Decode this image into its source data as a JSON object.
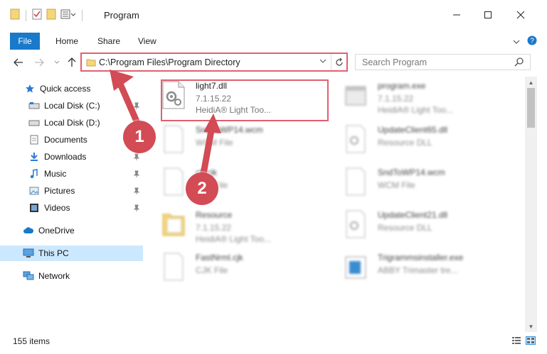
{
  "window": {
    "title": "Program"
  },
  "ribbon": {
    "tabs": [
      "File",
      "Home",
      "Share",
      "View"
    ]
  },
  "address": {
    "path": "C:\\Program Files\\Program Directory"
  },
  "search": {
    "placeholder": "Search Program"
  },
  "sidebar": {
    "items": [
      {
        "label": "Quick access",
        "icon": "star-icon"
      },
      {
        "label": "Local Disk (C:)",
        "icon": "drive-icon"
      },
      {
        "label": "Local Disk (D:)",
        "icon": "drive-icon"
      },
      {
        "label": "Documents",
        "icon": "documents-icon"
      },
      {
        "label": "Downloads",
        "icon": "downloads-icon"
      },
      {
        "label": "Music",
        "icon": "music-icon"
      },
      {
        "label": "Pictures",
        "icon": "pictures-icon"
      },
      {
        "label": "Videos",
        "icon": "videos-icon"
      },
      {
        "label": "OneDrive",
        "icon": "cloud-icon"
      },
      {
        "label": "This PC",
        "icon": "computer-icon"
      },
      {
        "label": "Network",
        "icon": "network-icon"
      }
    ]
  },
  "files": [
    {
      "name": "light7.dll",
      "line2": "7.1.15.22",
      "line3": "HeidiA® Light Too..."
    },
    {
      "name": "program.exe",
      "line2": "7.1.15.22",
      "line3": "HeidiA® Light Too..."
    },
    {
      "name": "SndToWP14.wcm",
      "line2": "WCM File",
      "line3": ""
    },
    {
      "name": "UpdateClient65.dll",
      "line2": "Resource DLL",
      "line3": ""
    },
    {
      "name": "cfl.cjk",
      "line2": "CJK File",
      "line3": ""
    },
    {
      "name": "SndToWP14.wcm",
      "line2": "WCM File",
      "line3": ""
    },
    {
      "name": "Resource",
      "line2": "7.1.15.22",
      "line3": "HeidiA® Light Too..."
    },
    {
      "name": "UpdateClient21.dll",
      "line2": "Resource DLL",
      "line3": ""
    },
    {
      "name": "FastNrml.cjk",
      "line2": "CJK File",
      "line3": ""
    },
    {
      "name": "Trigrammsinstaller.exe",
      "line2": "ABBY Trimaster tre...",
      "line3": ""
    }
  ],
  "status": {
    "count": "155 items"
  },
  "annotations": {
    "badge1": "1",
    "badge2": "2"
  },
  "colors": {
    "accent": "#1979ca",
    "highlight": "#e06070",
    "badge": "#d24b55",
    "selected": "#cce8ff"
  }
}
